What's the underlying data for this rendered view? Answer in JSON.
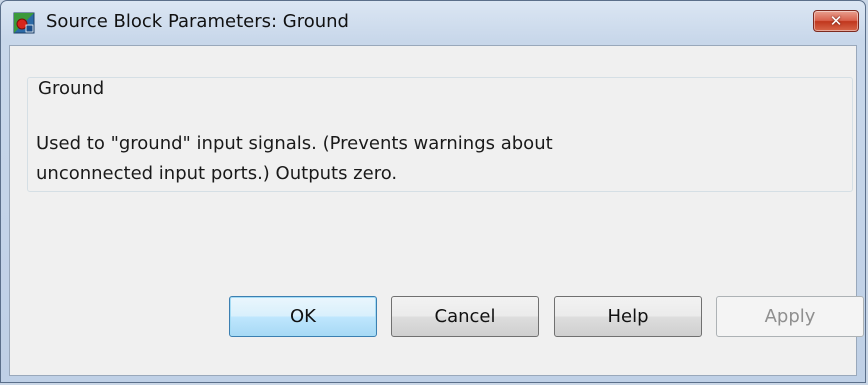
{
  "window": {
    "title": "Source Block Parameters: Ground",
    "close_label": "✕"
  },
  "group": {
    "legend": "Ground",
    "description_line1": "Used to \"ground\" input signals.  (Prevents warnings about",
    "description_line2": "unconnected input ports.)  Outputs zero."
  },
  "buttons": {
    "ok": "OK",
    "cancel": "Cancel",
    "help": "Help",
    "apply": "Apply"
  },
  "colors": {
    "title_bar": "#c8d7ea",
    "client_bg": "#f0f0f0",
    "close_button": "#c0361d",
    "default_button_border": "#3c7fb1"
  },
  "icons": {
    "app": "simulink-block-icon",
    "close": "close-icon"
  }
}
